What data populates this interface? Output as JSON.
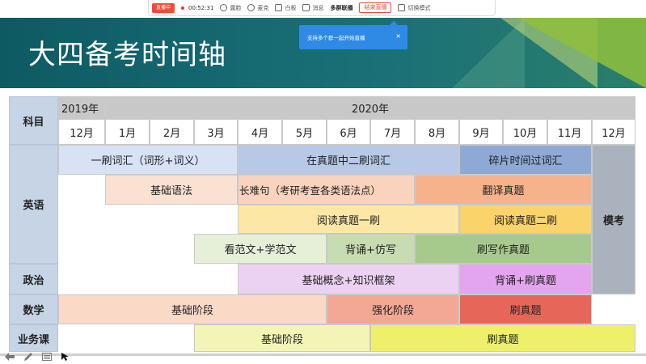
{
  "toolbar": {
    "live_badge": "直播中",
    "timer": "00:52:31",
    "items": [
      "露脸",
      "麦克",
      "白板",
      "消息"
    ],
    "multi": "多群联播",
    "end": "结束直播",
    "switch": "切换模式"
  },
  "tooltip": {
    "text": "支持多个群一起开始直播",
    "close": "×"
  },
  "slide": {
    "title": "大四备考时间轴"
  },
  "timeline": {
    "subject_header": "科目",
    "year_2019": "2019年",
    "year_2020": "2020年",
    "months": [
      "12月",
      "1月",
      "2月",
      "3月",
      "4月",
      "5月",
      "6月",
      "7月",
      "8月",
      "9月",
      "10月",
      "11月",
      "12月"
    ],
    "subjects": {
      "english": "英语",
      "politics": "政治",
      "math": "数学",
      "major": "业务课"
    },
    "mock_exam": "模考",
    "blocks": {
      "vocab1": "一刷词汇（词形+词义）",
      "vocab2": "在真题中二刷词汇",
      "vocab3": "碎片时间过词汇",
      "grammar": "基础语法",
      "long_sent": "长难句（考研考查各类语法点）",
      "translate": "翻译真题",
      "read1": "阅读真题一刷",
      "read2": "阅读真题二刷",
      "essay_model": "看范文+学范文",
      "recite": "背诵+仿写",
      "essay_real": "刷写作真题",
      "pol_basic": "基础概念+知识框架",
      "pol_recite": "背诵+刷真题",
      "math_basic": "基础阶段",
      "math_strong": "强化阶段",
      "math_real": "刷真题",
      "major_basic": "基础阶段",
      "major_real": "刷真题"
    }
  },
  "colors": {
    "live_red": "#f04b3a",
    "tooltip_blue": "#2f8ae6",
    "header_teal": "#176c74",
    "vocab1": "#d7e3f4",
    "vocab2": "#b7c9e6",
    "vocab3": "#8ea9d6",
    "grammar": "#fbe1d2",
    "long_sent": "#f9d3bd",
    "translate": "#f6b28a",
    "read1": "#fce7a6",
    "read2": "#fad36a",
    "essay_model": "#e6efd8",
    "recite": "#c7dcb0",
    "essay_real": "#a6c98c",
    "pol_basic": "#ecd2f2",
    "pol_recite": "#e3a5ef",
    "math_basic": "#fad9c7",
    "math_strong": "#f2a893",
    "math_real": "#e7665a",
    "major_basic": "#f3f5b6",
    "major_real": "#eef06a",
    "mock": "#aab3bd"
  }
}
